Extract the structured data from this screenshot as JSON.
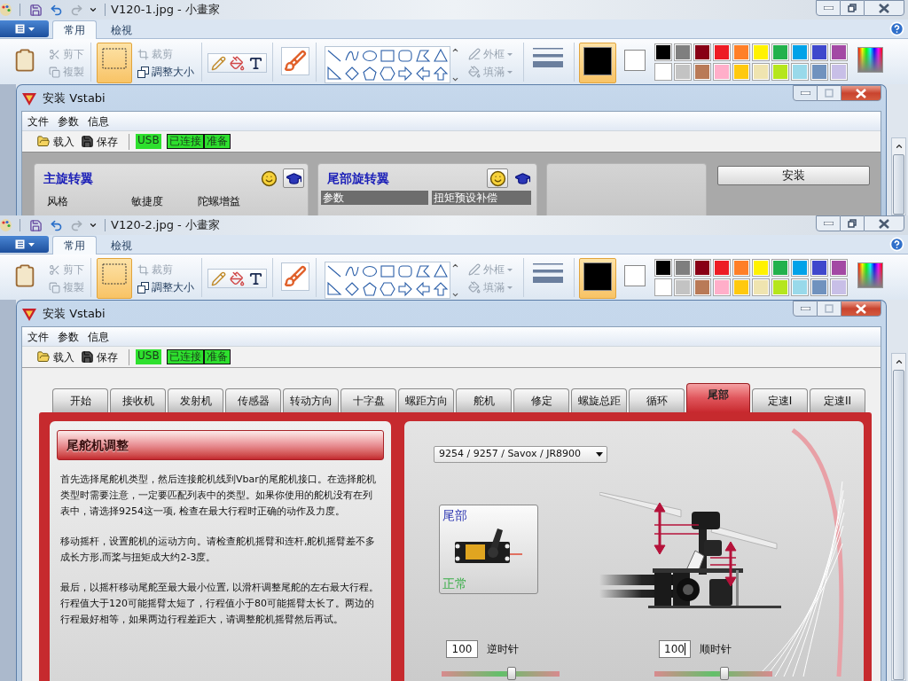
{
  "screens": [
    {
      "paint": {
        "title": "V120-1.jpg - 小畫家",
        "ribbon_tabs": [
          {
            "label": "常用",
            "selected": true
          },
          {
            "label": "檢視",
            "selected": false
          }
        ],
        "clipboard": [
          {
            "label": "剪下",
            "disabled": true
          },
          {
            "label": "複製",
            "disabled": true
          }
        ],
        "selection_tool": {
          "selected": true
        },
        "image_tools": [
          {
            "label": "裁剪",
            "disabled": true
          },
          {
            "label": "調整大小",
            "disabled": false
          }
        ],
        "shape_options": [
          {
            "label": "外框",
            "disabled": true
          },
          {
            "label": "填滿",
            "disabled": true
          }
        ],
        "active_colors": [
          {
            "color": "#000000",
            "selected": true
          },
          {
            "color": "#ffffff",
            "selected": false
          }
        ],
        "palette": [
          {
            "color": "#000000"
          },
          {
            "color": "#7f7f7f"
          },
          {
            "color": "#880015"
          },
          {
            "color": "#ed1c24"
          },
          {
            "color": "#ff7f27"
          },
          {
            "color": "#fff200"
          },
          {
            "color": "#22b14c"
          },
          {
            "color": "#00a2e8"
          },
          {
            "color": "#3f48cc"
          },
          {
            "color": "#a349a4"
          },
          {
            "color": "#ffffff"
          },
          {
            "color": "#c3c3c3"
          },
          {
            "color": "#b97a57"
          },
          {
            "color": "#ffaec9"
          },
          {
            "color": "#ffc90e"
          },
          {
            "color": "#efe4b0"
          },
          {
            "color": "#b5e61d"
          },
          {
            "color": "#99d9ea"
          },
          {
            "color": "#7092be"
          },
          {
            "color": "#c8bfe7"
          }
        ]
      },
      "vstabi": {
        "title": "安装 Vstabi",
        "menu": [
          "文件",
          "参数",
          "信息"
        ],
        "toolbar": [
          {
            "label": "载入",
            "kind": "open"
          },
          {
            "label": "保存",
            "kind": "save"
          }
        ],
        "status": [
          {
            "label": "USB",
            "active": true
          },
          {
            "label": "已连接",
            "active": true
          },
          {
            "label": "准备",
            "active": true
          }
        ],
        "overview": {
          "panels": [
            {
              "title": "主旋转翼",
              "mode_buttons": [
                {
                  "kind": "smiley",
                  "selected": false
                },
                {
                  "kind": "expert",
                  "selected": true
                }
              ],
              "labels": [
                "风格",
                "敏捷度",
                "陀螺增益"
              ]
            },
            {
              "title": "尾部旋转翼",
              "mode_buttons": [
                {
                  "kind": "smiley",
                  "selected": true
                },
                {
                  "kind": "expert",
                  "selected": false
                }
              ],
              "columns": [
                "参数",
                "扭矩预设补偿"
              ]
            }
          ],
          "install_button": "安装"
        }
      }
    },
    {
      "paint": {
        "title": "V120-2.jpg - 小畫家",
        "ribbon_tabs": [
          {
            "label": "常用",
            "selected": true
          },
          {
            "label": "檢視",
            "selected": false
          }
        ],
        "clipboard": [
          {
            "label": "剪下",
            "disabled": true
          },
          {
            "label": "複製",
            "disabled": true
          }
        ],
        "selection_tool": {
          "selected": true
        },
        "image_tools": [
          {
            "label": "裁剪",
            "disabled": true
          },
          {
            "label": "調整大小",
            "disabled": false
          }
        ],
        "shape_options": [
          {
            "label": "外框",
            "disabled": true
          },
          {
            "label": "填滿",
            "disabled": true
          }
        ],
        "active_colors": [
          {
            "color": "#000000",
            "selected": true
          },
          {
            "color": "#ffffff",
            "selected": false
          }
        ],
        "palette": [
          {
            "color": "#000000"
          },
          {
            "color": "#7f7f7f"
          },
          {
            "color": "#880015"
          },
          {
            "color": "#ed1c24"
          },
          {
            "color": "#ff7f27"
          },
          {
            "color": "#fff200"
          },
          {
            "color": "#22b14c"
          },
          {
            "color": "#00a2e8"
          },
          {
            "color": "#3f48cc"
          },
          {
            "color": "#a349a4"
          },
          {
            "color": "#ffffff"
          },
          {
            "color": "#c3c3c3"
          },
          {
            "color": "#b97a57"
          },
          {
            "color": "#ffaec9"
          },
          {
            "color": "#ffc90e"
          },
          {
            "color": "#efe4b0"
          },
          {
            "color": "#b5e61d"
          },
          {
            "color": "#99d9ea"
          },
          {
            "color": "#7092be"
          },
          {
            "color": "#c8bfe7"
          }
        ]
      },
      "vstabi": {
        "title": "安装 Vstabi",
        "menu": [
          "文件",
          "参数",
          "信息"
        ],
        "toolbar": [
          {
            "label": "载入",
            "kind": "open"
          },
          {
            "label": "保存",
            "kind": "save"
          }
        ],
        "status": [
          {
            "label": "USB",
            "active": true
          },
          {
            "label": "已连接",
            "active": true
          },
          {
            "label": "准备",
            "active": true
          }
        ],
        "tabs": [
          {
            "label": "开始",
            "selected": false
          },
          {
            "label": "接收机",
            "selected": false
          },
          {
            "label": "发射机",
            "selected": false
          },
          {
            "label": "传感器",
            "selected": false
          },
          {
            "label": "转动方向",
            "selected": false
          },
          {
            "label": "十字盘",
            "selected": false
          },
          {
            "label": "螺距方向",
            "selected": false
          },
          {
            "label": "舵机",
            "selected": false
          },
          {
            "label": "修定",
            "selected": false
          },
          {
            "label": "螺旋总距",
            "selected": false
          },
          {
            "label": "循环",
            "selected": false
          },
          {
            "label": "尾部",
            "selected": true
          },
          {
            "label": "定速I",
            "selected": false
          },
          {
            "label": "定速II",
            "selected": false
          }
        ],
        "tail_page": {
          "heading": "尾舵机调整",
          "paragraphs": [
            "首先选择尾舵机类型，然后连接舵机线到Vbar的尾舵机接口。在选择舵机类型时需要注意，一定要匹配列表中的类型。如果你使用的舵机没有在列表中，请选择9254这一项, 检查在最大行程时正确的动作及力度。",
            "移动摇杆，设置舵机的运动方向。请检查舵机摇臂和连杆,舵机摇臂差不多成长方形,而桨与扭矩成大约2-3度。",
            "最后，以摇杆移动尾舵至最大最小位置, 以滑杆调整尾舵的左右最大行程。行程值大于120可能摇臂太短了，行程值小于80可能摇臂太长了。两边的行程最好相等，如果两边行程差距大，请调整舵机摇臂然后再试。"
          ],
          "servo_type": "9254 / 9257 / Savox / JR8900",
          "servo_card": {
            "title": "尾部",
            "status": "正常"
          },
          "travel": [
            {
              "value": "100",
              "label": "逆时针",
              "focused": false,
              "level": 0.6
            },
            {
              "value": "100",
              "label": "顺时针",
              "focused": true,
              "level": 0.6
            }
          ]
        }
      }
    }
  ]
}
